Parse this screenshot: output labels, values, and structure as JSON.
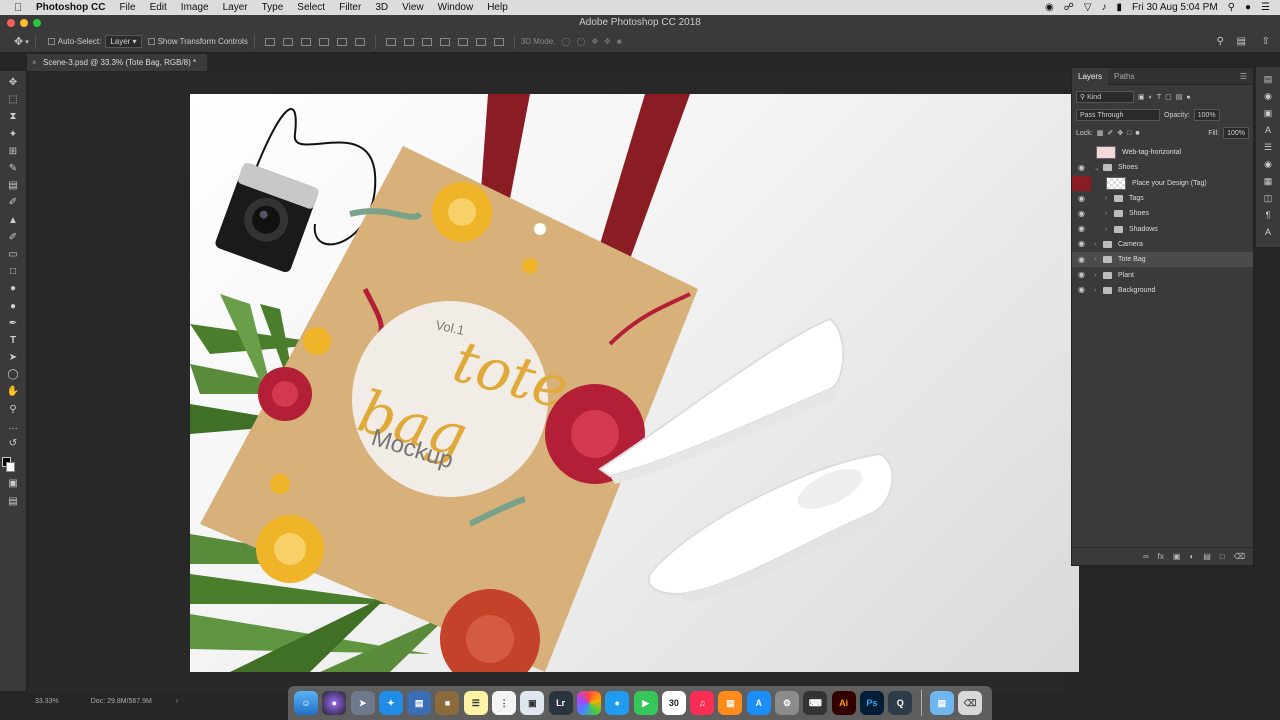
{
  "menubar": {
    "app_name": "Photoshop CC",
    "items": [
      "File",
      "Edit",
      "Image",
      "Layer",
      "Type",
      "Select",
      "Filter",
      "3D",
      "View",
      "Window",
      "Help"
    ],
    "clock": "Fri 30 Aug  5:04 PM"
  },
  "window": {
    "title": "Adobe Photoshop CC 2018"
  },
  "options_bar": {
    "auto_select_label": "Auto-Select:",
    "auto_select_value": "Layer",
    "show_transform_label": "Show Transform Controls",
    "mode_3d_label": "3D Mode:"
  },
  "document_tab": {
    "label": "Scene-3.psd @ 33.3% (Tote Bag, RGB/8) *"
  },
  "status": {
    "zoom": "33.33%",
    "doc": "Doc: 29.8M/567.9M"
  },
  "layers_panel": {
    "tabs": [
      "Layers",
      "Paths"
    ],
    "filter_kind": "Kind",
    "blend_mode": "Pass Through",
    "opacity_label": "Opacity:",
    "opacity_value": "100%",
    "lock_label": "Lock:",
    "fill_label": "Fill:",
    "fill_value": "100%",
    "layers": [
      {
        "name": "Web-tag-horizontal",
        "visible": false,
        "indent": 0,
        "kind": "smart"
      },
      {
        "name": "Shoes",
        "visible": true,
        "indent": 0,
        "kind": "group-open"
      },
      {
        "name": "Place your Design (Tag)",
        "visible": false,
        "indent": 1,
        "kind": "smart"
      },
      {
        "name": "Tags",
        "visible": true,
        "indent": 1,
        "kind": "group"
      },
      {
        "name": "Shoes",
        "visible": true,
        "indent": 1,
        "kind": "group"
      },
      {
        "name": "Shadows",
        "visible": true,
        "indent": 1,
        "kind": "group"
      },
      {
        "name": "Camera",
        "visible": true,
        "indent": 0,
        "kind": "group"
      },
      {
        "name": "Tote Bag",
        "visible": true,
        "indent": 0,
        "kind": "group",
        "selected": true
      },
      {
        "name": "Plant",
        "visible": true,
        "indent": 0,
        "kind": "group"
      },
      {
        "name": "Background",
        "visible": true,
        "indent": 0,
        "kind": "group"
      }
    ]
  },
  "artwork": {
    "vol": "Vol.1",
    "line1": "tote",
    "line2": "bag",
    "line3": "Mockup"
  },
  "dock": {
    "lr_label": "Lr",
    "ai_label": "Ai",
    "ps_label": "Ps",
    "calendar_day": "30"
  },
  "colors": {
    "bag": "#d8b07a",
    "strap": "#8a1c23",
    "flower_red": "#b21f37",
    "flower_yellow": "#f0b429",
    "leaf": "#5a8b3a"
  }
}
